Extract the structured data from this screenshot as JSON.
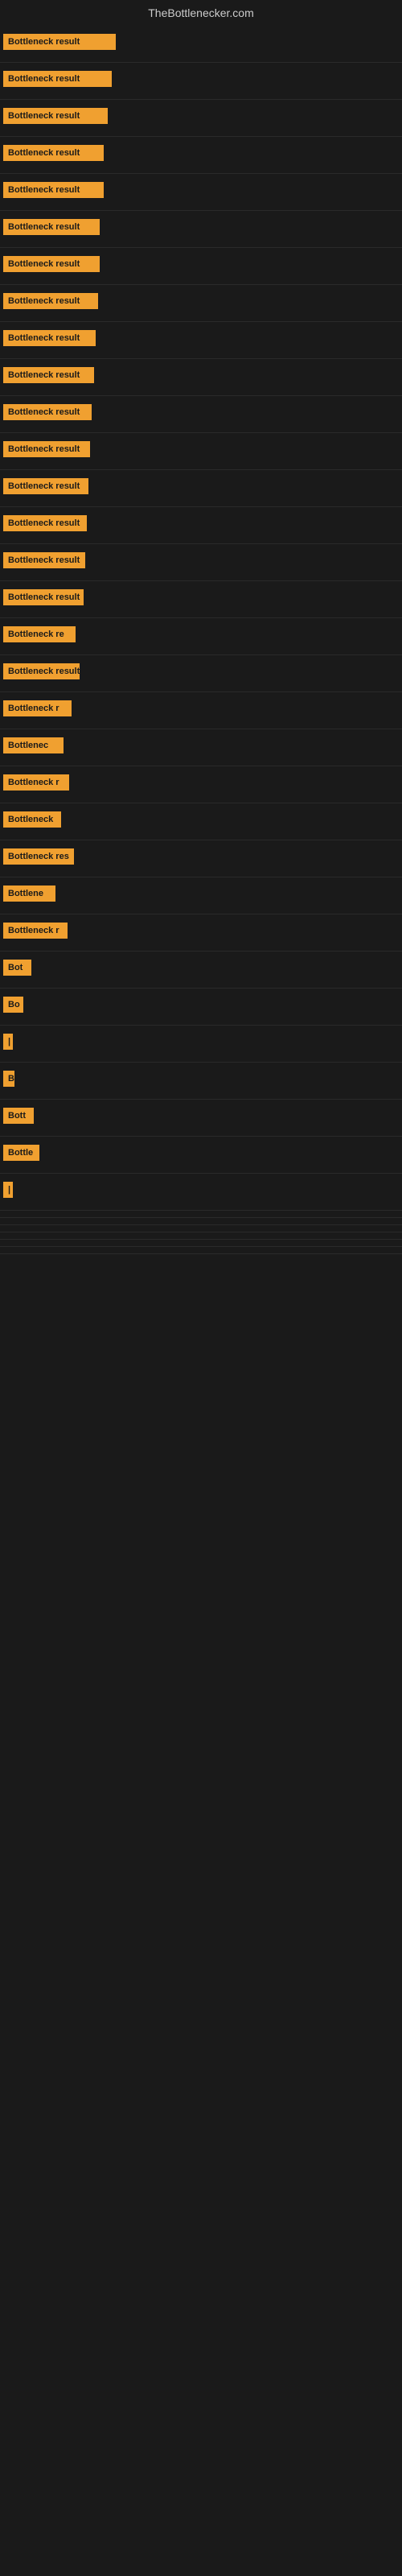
{
  "site": {
    "title": "TheBottlenecker.com"
  },
  "bars": [
    {
      "label": "Bottleneck result",
      "width": 140
    },
    {
      "label": "Bottleneck result",
      "width": 135
    },
    {
      "label": "Bottleneck result",
      "width": 130
    },
    {
      "label": "Bottleneck result",
      "width": 125
    },
    {
      "label": "Bottleneck result",
      "width": 125
    },
    {
      "label": "Bottleneck result",
      "width": 120
    },
    {
      "label": "Bottleneck result",
      "width": 120
    },
    {
      "label": "Bottleneck result",
      "width": 118
    },
    {
      "label": "Bottleneck result",
      "width": 115
    },
    {
      "label": "Bottleneck result",
      "width": 113
    },
    {
      "label": "Bottleneck result",
      "width": 110
    },
    {
      "label": "Bottleneck result",
      "width": 108
    },
    {
      "label": "Bottleneck result",
      "width": 106
    },
    {
      "label": "Bottleneck result",
      "width": 104
    },
    {
      "label": "Bottleneck result",
      "width": 102
    },
    {
      "label": "Bottleneck result",
      "width": 100
    },
    {
      "label": "Bottleneck re",
      "width": 90
    },
    {
      "label": "Bottleneck result",
      "width": 95
    },
    {
      "label": "Bottleneck r",
      "width": 85
    },
    {
      "label": "Bottlenec",
      "width": 75
    },
    {
      "label": "Bottleneck r",
      "width": 82
    },
    {
      "label": "Bottleneck",
      "width": 72
    },
    {
      "label": "Bottleneck res",
      "width": 88
    },
    {
      "label": "Bottlene",
      "width": 65
    },
    {
      "label": "Bottleneck r",
      "width": 80
    },
    {
      "label": "Bot",
      "width": 35
    },
    {
      "label": "Bo",
      "width": 25
    },
    {
      "label": "|",
      "width": 8
    },
    {
      "label": "B",
      "width": 14
    },
    {
      "label": "Bott",
      "width": 38
    },
    {
      "label": "Bottle",
      "width": 45
    },
    {
      "label": "|",
      "width": 6
    },
    {
      "label": "",
      "width": 0
    },
    {
      "label": "",
      "width": 0
    },
    {
      "label": "",
      "width": 0
    },
    {
      "label": "",
      "width": 0
    },
    {
      "label": "",
      "width": 0
    },
    {
      "label": "",
      "width": 0
    }
  ]
}
